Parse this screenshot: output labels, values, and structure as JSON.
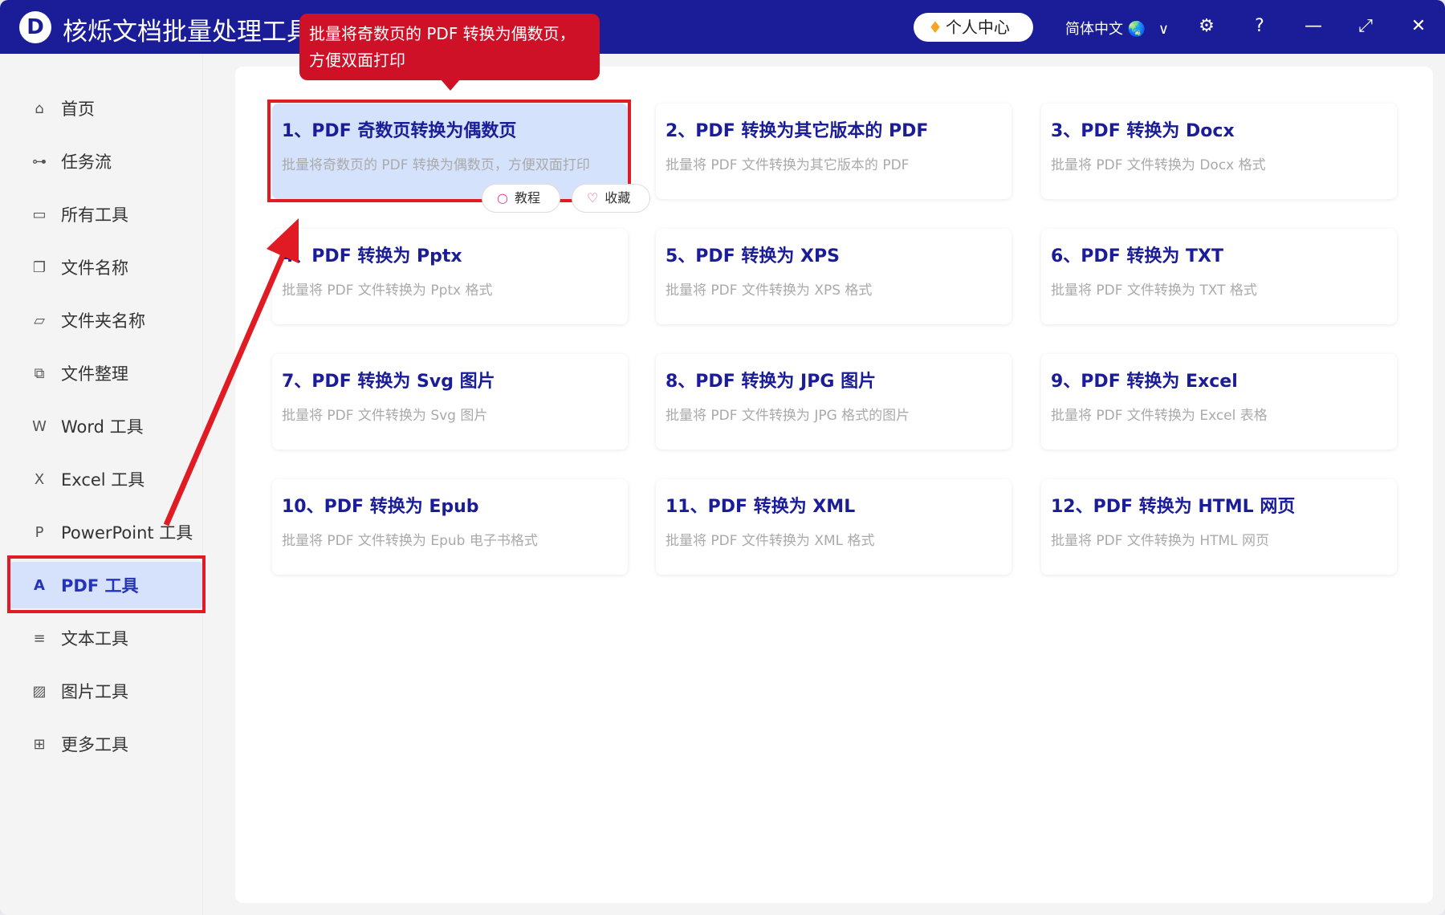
{
  "app": {
    "title": "核烁文档批量处理工具",
    "logo_letter": "D"
  },
  "header": {
    "vip_label": "个人中心",
    "language": "简体中文",
    "icons": [
      "settings-icon",
      "help-icon",
      "minimize-icon",
      "maximize-icon",
      "close-icon"
    ]
  },
  "tooltip": {
    "line1": "批量将奇数页的 PDF 转换为偶数页，",
    "line2": "方便双面打印"
  },
  "sidebar": {
    "items": [
      {
        "label": "首页",
        "icon": "⌂"
      },
      {
        "label": "任务流",
        "icon": "⊶"
      },
      {
        "label": "所有工具",
        "icon": "▭"
      },
      {
        "label": "文件名称",
        "icon": "❐"
      },
      {
        "label": "文件夹名称",
        "icon": "▱"
      },
      {
        "label": "文件整理",
        "icon": "⧉"
      },
      {
        "label": "Word 工具",
        "icon": "W"
      },
      {
        "label": "Excel 工具",
        "icon": "X"
      },
      {
        "label": "PowerPoint 工具",
        "icon": "P"
      },
      {
        "label": "PDF 工具",
        "icon": "A"
      },
      {
        "label": "文本工具",
        "icon": "≡"
      },
      {
        "label": "图片工具",
        "icon": "▨"
      },
      {
        "label": "更多工具",
        "icon": "⊞"
      }
    ],
    "active_index": 9
  },
  "cards": [
    {
      "title": "1、PDF 奇数页转换为偶数页",
      "desc": "批量将奇数页的 PDF 转换为偶数页，方便双面打印"
    },
    {
      "title": "2、PDF 转换为其它版本的 PDF",
      "desc": "批量将 PDF 文件转换为其它版本的 PDF"
    },
    {
      "title": "3、PDF 转换为 Docx",
      "desc": "批量将 PDF 文件转换为 Docx 格式"
    },
    {
      "title": "4、PDF 转换为 Pptx",
      "desc": "批量将 PDF 文件转换为 Pptx 格式"
    },
    {
      "title": "5、PDF 转换为 XPS",
      "desc": "批量将 PDF 文件转换为 XPS 格式"
    },
    {
      "title": "6、PDF 转换为 TXT",
      "desc": "批量将 PDF 文件转换为 TXT 格式"
    },
    {
      "title": "7、PDF 转换为 Svg 图片",
      "desc": "批量将 PDF 文件转换为 Svg 图片"
    },
    {
      "title": "8、PDF 转换为 JPG 图片",
      "desc": "批量将 PDF 文件转换为 JPG 格式的图片"
    },
    {
      "title": "9、PDF 转换为 Excel",
      "desc": "批量将 PDF 文件转换为 Excel 表格"
    },
    {
      "title": "10、PDF 转换为 Epub",
      "desc": "批量将 PDF 文件转换为 Epub 电子书格式"
    },
    {
      "title": "11、PDF 转换为 XML",
      "desc": "批量将 PDF 文件转换为 XML 格式"
    },
    {
      "title": "12、PDF 转换为 HTML 网页",
      "desc": "批量将 PDF 文件转换为 HTML 网页"
    }
  ],
  "card_actions": {
    "tutorial": "教程",
    "favorite": "收藏"
  },
  "colors": {
    "titlebar": "#1a1d97",
    "accent": "#2533b8",
    "annotation": "#e01b24"
  }
}
